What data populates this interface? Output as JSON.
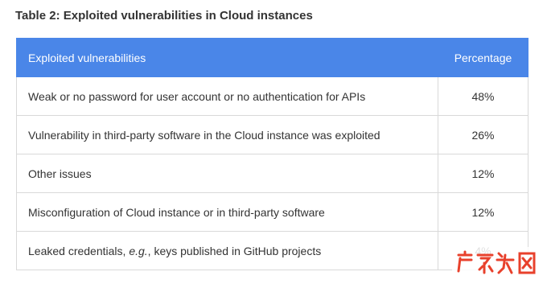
{
  "caption": "Table 2: Exploited vulnerabilities in Cloud instances",
  "table": {
    "headers": [
      "Exploited vulnerabilities",
      "Percentage"
    ],
    "rows": [
      {
        "label": "Weak or no password for user account or no authentication for APIs",
        "pct": "48%"
      },
      {
        "label": "Vulnerability in third-party software in the Cloud instance was exploited",
        "pct": "26%"
      },
      {
        "label": "Other issues",
        "pct": "12%"
      },
      {
        "label": "Misconfiguration of Cloud instance or in third-party software",
        "pct": "12%"
      },
      {
        "label_parts": [
          "Leaked credentials, ",
          "e.g.",
          ", keys published in GitHub projects"
        ],
        "pct": "4%"
      }
    ]
  },
  "watermark": {
    "text": "广东龙网",
    "color": "#e8412c"
  },
  "colors": {
    "header_bg": "#4a86e8",
    "border": "#d9d9d9",
    "text": "#333333"
  }
}
